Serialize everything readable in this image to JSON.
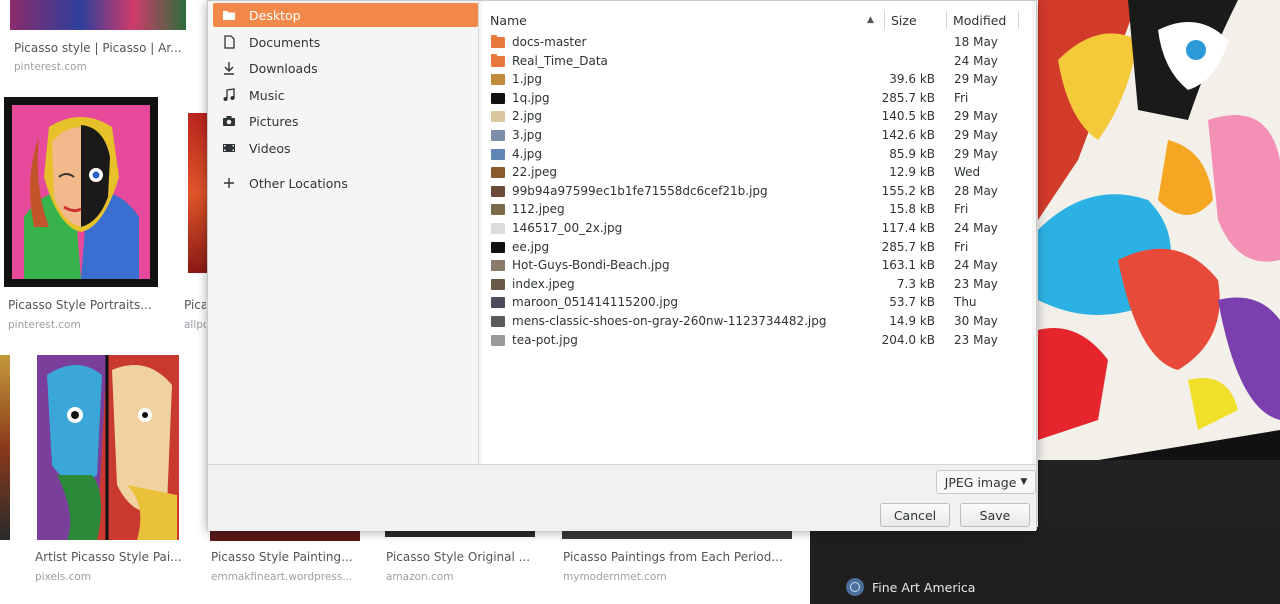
{
  "background": {
    "results": [
      {
        "caption": "Picasso style | Picasso | Ar...",
        "source": "pinterest.com"
      },
      {
        "caption": "Picasso Style Portraits...",
        "source": "pinterest.com"
      },
      {
        "caption": "Pica",
        "source": "allpo"
      },
      {
        "caption": "Artist Picasso Style Pai...",
        "source": "pixels.com"
      },
      {
        "caption": "Picasso Style Painting...",
        "source": "emmakfineart.wordpress..."
      },
      {
        "caption": "Picasso Style Original ...",
        "source": "amazon.com"
      },
      {
        "caption": "Picasso Paintings from Each Period...",
        "source": "mymodernmet.com"
      }
    ],
    "preview_source": "Fine Art America"
  },
  "dialog": {
    "places": [
      {
        "label": "Desktop",
        "icon": "folder-icon",
        "active": true
      },
      {
        "label": "Documents",
        "icon": "document-icon"
      },
      {
        "label": "Downloads",
        "icon": "download-icon"
      },
      {
        "label": "Music",
        "icon": "music-icon"
      },
      {
        "label": "Pictures",
        "icon": "camera-icon"
      },
      {
        "label": "Videos",
        "icon": "video-icon"
      }
    ],
    "other_locations": "Other Locations",
    "columns": {
      "name": "Name",
      "size": "Size",
      "modified": "Modified"
    },
    "files": [
      {
        "name": "docs-master",
        "size": "",
        "modified": "18 May",
        "type": "folder"
      },
      {
        "name": "Real_Time_Data",
        "size": "",
        "modified": "24 May",
        "type": "folder"
      },
      {
        "name": "1.jpg",
        "size": "39.6 kB",
        "modified": "29 May",
        "color": "#c08a3a"
      },
      {
        "name": "1q.jpg",
        "size": "285.7 kB",
        "modified": "Fri",
        "color": "#111111"
      },
      {
        "name": "2.jpg",
        "size": "140.5 kB",
        "modified": "29 May",
        "color": "#d9c7a0"
      },
      {
        "name": "3.jpg",
        "size": "142.6 kB",
        "modified": "29 May",
        "color": "#7c8da8"
      },
      {
        "name": "4.jpg",
        "size": "85.9 kB",
        "modified": "29 May",
        "color": "#5f86b5"
      },
      {
        "name": "22.jpeg",
        "size": "12.9 kB",
        "modified": "Wed",
        "color": "#8a5a2b"
      },
      {
        "name": "99b94a97599ec1b1fe71558dc6cef21b.jpg",
        "size": "155.2 kB",
        "modified": "28 May",
        "color": "#6b4a3a"
      },
      {
        "name": "112.jpeg",
        "size": "15.8 kB",
        "modified": "Fri",
        "color": "#7a6a4a"
      },
      {
        "name": "146517_00_2x.jpg",
        "size": "117.4 kB",
        "modified": "24 May",
        "color": "#dcdcdc"
      },
      {
        "name": "ee.jpg",
        "size": "285.7 kB",
        "modified": "Fri",
        "color": "#111111"
      },
      {
        "name": "Hot-Guys-Bondi-Beach.jpg",
        "size": "163.1 kB",
        "modified": "24 May",
        "color": "#8a7a6a"
      },
      {
        "name": "index.jpeg",
        "size": "7.3 kB",
        "modified": "23 May",
        "color": "#6a5a4a"
      },
      {
        "name": "maroon_051414115200.jpg",
        "size": "53.7 kB",
        "modified": "Thu",
        "color": "#4a4a5a"
      },
      {
        "name": "mens-classic-shoes-on-gray-260nw-1123734482.jpg",
        "size": "14.9 kB",
        "modified": "30 May",
        "color": "#5a5a5a"
      },
      {
        "name": "tea-pot.jpg",
        "size": "204.0 kB",
        "modified": "23 May",
        "color": "#9a9a9a"
      }
    ],
    "filter": "JPEG image",
    "cancel": "Cancel",
    "save": "Save"
  }
}
